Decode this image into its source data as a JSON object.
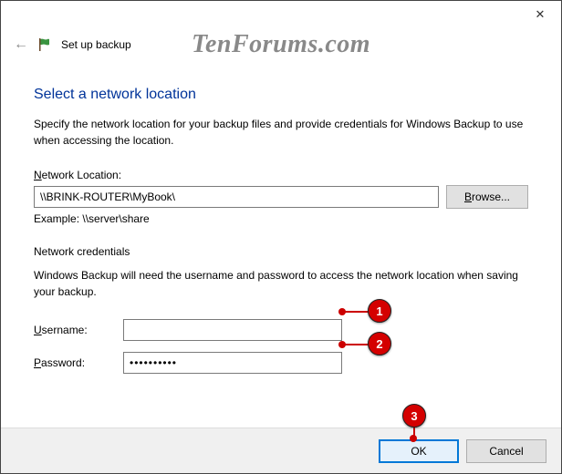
{
  "window": {
    "title": "Set up backup",
    "close_glyph": "✕"
  },
  "watermark": "TenForums.com",
  "heading": "Select a network location",
  "description": "Specify the network location for your backup files and provide credentials for Windows Backup to use when accessing the location.",
  "location": {
    "label_pre": "N",
    "label_post": "etwork Location:",
    "value": "\\\\BRINK-ROUTER\\MyBook\\",
    "browse_pre": "B",
    "browse_post": "rowse...",
    "example": "Example: \\\\server\\share"
  },
  "credentials": {
    "header": "Network credentials",
    "desc": "Windows Backup will need the username and password to access the network location when saving your backup.",
    "user_pre": "U",
    "user_post": "sername:",
    "user_value": "",
    "pass_pre": "P",
    "pass_post": "assword:",
    "pass_value": "••••••••••"
  },
  "footer": {
    "ok": "OK",
    "cancel": "Cancel"
  },
  "annotations": {
    "b1": "1",
    "b2": "2",
    "b3": "3"
  }
}
